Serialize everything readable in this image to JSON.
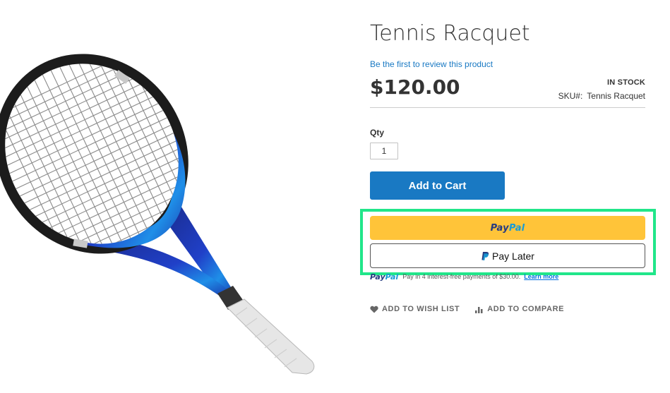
{
  "product": {
    "title": "Tennis Racquet",
    "review_link": "Be the first to review this product",
    "price": "$120.00",
    "stock_status": "IN STOCK",
    "sku_label": "SKU#:",
    "sku_value": "Tennis Racquet"
  },
  "qty": {
    "label": "Qty",
    "value": "1"
  },
  "cart": {
    "add_to_cart_label": "Add to Cart"
  },
  "paypal": {
    "button_word_dark": "Pay",
    "button_word_light": "Pal",
    "pay_later_label": "Pay Later",
    "message_logo_dark": "Pay",
    "message_logo_light": "Pal",
    "message_text": "Pay in 4 interest-free payments of $30.00.",
    "learn_more": "Learn more",
    "highlight_color": "#21e68a",
    "button_color": "#ffc439"
  },
  "actions": {
    "wishlist_label": "ADD TO WISH LIST",
    "wishlist_icon": "heart-icon",
    "compare_label": "ADD TO COMPARE",
    "compare_icon": "bar-chart-icon"
  },
  "colors": {
    "accent": "#1979c3",
    "text": "#333333"
  }
}
